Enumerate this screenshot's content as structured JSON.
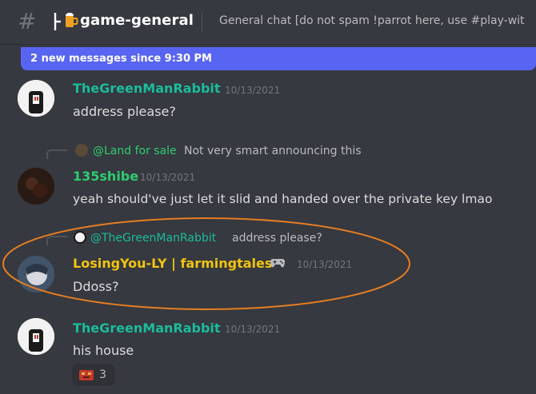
{
  "header": {
    "channel_name": "game-general",
    "topic": "General chat [do not spam !parrot here, use #play-wit"
  },
  "new_messages_bar": {
    "text": "2 new messages since 9:30 PM"
  },
  "messages": [
    {
      "username": "TheGreenManRabbit",
      "username_color": "#1abc9c",
      "timestamp": "10/13/2021",
      "text": "address please?"
    },
    {
      "reply": {
        "username": "@Land for sale",
        "username_color": "#2ecc71",
        "text": "Not very smart announcing this"
      },
      "username": "135shibe",
      "username_color": "#2ecc71",
      "timestamp": "10/13/2021",
      "text": "yeah should've just let it slid and handed over the private key lmao"
    },
    {
      "reply": {
        "username": "@TheGreenManRabbit",
        "username_color": "#1abc9c",
        "text": "address please?"
      },
      "username": "LosingYou-LY | farmingtales",
      "username_color": "#f1c40f",
      "badge_icon": "gamepad-icon",
      "timestamp": "10/13/2021",
      "text": "Ddoss?"
    },
    {
      "username": "TheGreenManRabbit",
      "username_color": "#1abc9c",
      "timestamp": "10/13/2021",
      "text": "his house",
      "reaction": {
        "icon": "emoji-reaction-icon",
        "count": "3"
      }
    }
  ],
  "colors": {
    "background": "#36393f",
    "accent": "#5865f2",
    "highlight_ellipse": "#e67e22"
  }
}
